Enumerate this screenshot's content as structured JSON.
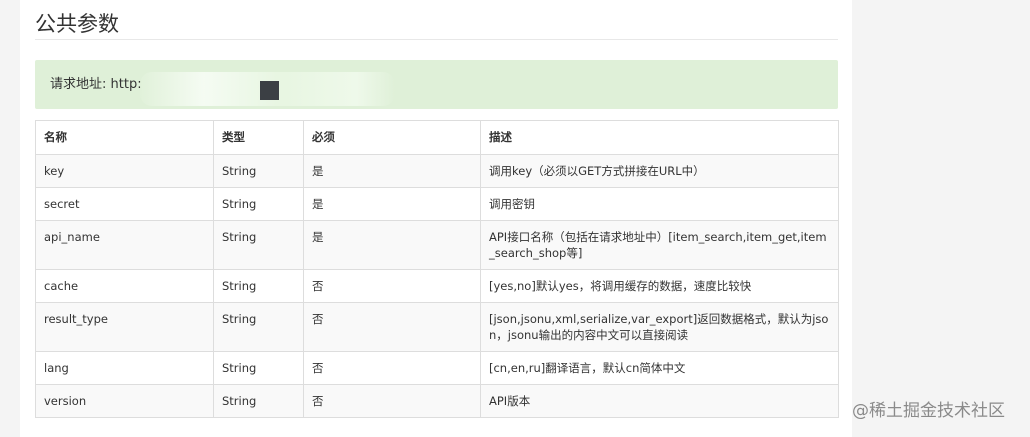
{
  "section": {
    "title": "公共参数"
  },
  "request": {
    "label": "请求地址: http:"
  },
  "table": {
    "headers": [
      "名称",
      "类型",
      "必须",
      "描述"
    ],
    "rows": [
      {
        "name": "key",
        "type": "String",
        "required": "是",
        "description": "调用key（必须以GET方式拼接在URL中）"
      },
      {
        "name": "secret",
        "type": "String",
        "required": "是",
        "description": "调用密钥"
      },
      {
        "name": "api_name",
        "type": "String",
        "required": "是",
        "description": "API接口名称（包括在请求地址中）[item_search,item_get,item_search_shop等]"
      },
      {
        "name": "cache",
        "type": "String",
        "required": "否",
        "description": "[yes,no]默认yes，将调用缓存的数据，速度比较快"
      },
      {
        "name": "result_type",
        "type": "String",
        "required": "否",
        "description": "[json,jsonu,xml,serialize,var_export]返回数据格式，默认为json，jsonu输出的内容中文可以直接阅读"
      },
      {
        "name": "lang",
        "type": "String",
        "required": "否",
        "description": "[cn,en,ru]翻译语言，默认cn简体中文"
      },
      {
        "name": "version",
        "type": "String",
        "required": "否",
        "description": "API版本"
      }
    ]
  },
  "watermark": {
    "text": "@稀土掘金技术社区"
  }
}
